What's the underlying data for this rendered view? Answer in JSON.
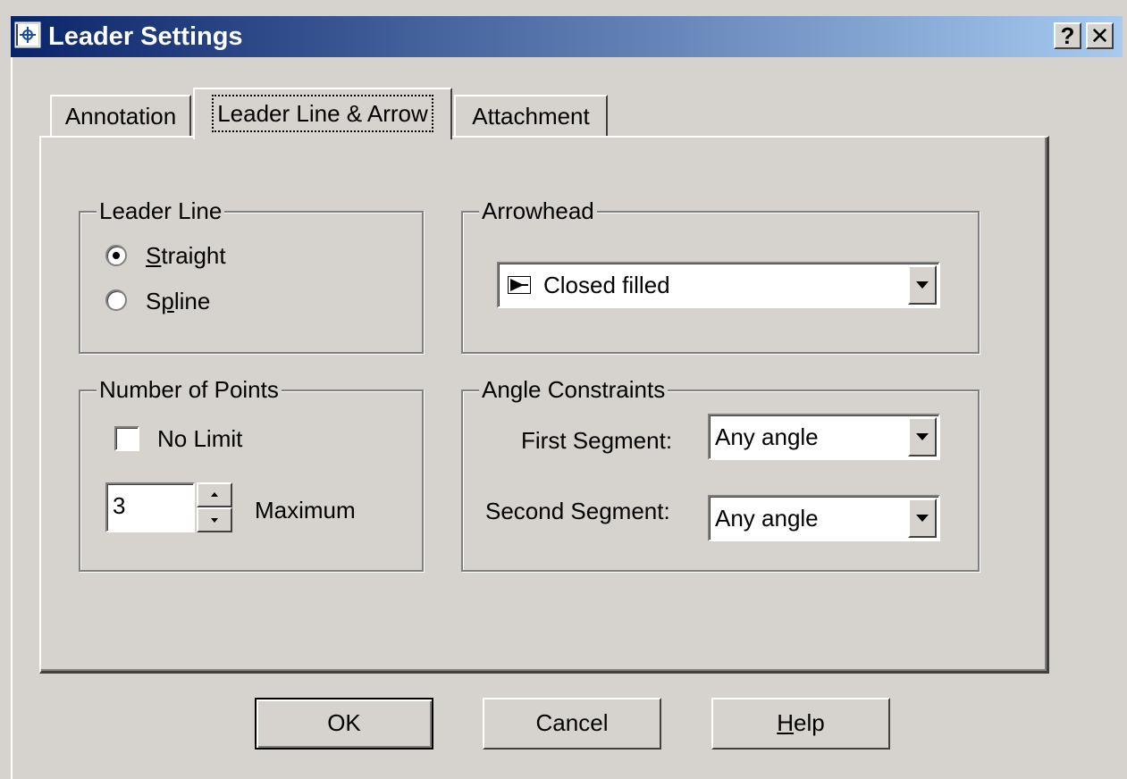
{
  "window": {
    "title": "Leader Settings",
    "icon": "leader-settings-icon",
    "help_glyph": "?",
    "close_glyph": "✕"
  },
  "tabs": [
    {
      "label": "Annotation",
      "selected": false
    },
    {
      "label": "Leader Line & Arrow",
      "selected": true
    },
    {
      "label": "Attachment",
      "selected": false
    }
  ],
  "leader_line": {
    "legend": "Leader Line",
    "options": [
      {
        "label_first": "S",
        "label_rest": "traight",
        "checked": true
      },
      {
        "label_first": "S",
        "label_mid": "p",
        "label_rest": "line",
        "checked": false
      }
    ]
  },
  "arrowhead": {
    "legend": "Arrowhead",
    "selected": "Closed filled",
    "icon": "closed-filled-arrow-icon"
  },
  "number_of_points": {
    "legend": "Number of Points",
    "no_limit_label": "No Limit",
    "no_limit_checked": false,
    "maximum_value": "3",
    "maximum_label": "Maximum"
  },
  "angle_constraints": {
    "legend": "Angle Constraints",
    "first_label": "First Segment:",
    "first_value": "Any angle",
    "second_label": "Second Segment:",
    "second_value": "Any angle"
  },
  "buttons": {
    "ok": "OK",
    "cancel": "Cancel",
    "help_first": "H",
    "help_rest": "elp"
  },
  "colors": {
    "face": "#d6d3ce",
    "titlebar_start": "#0a246a",
    "titlebar_end": "#a6caf0"
  }
}
